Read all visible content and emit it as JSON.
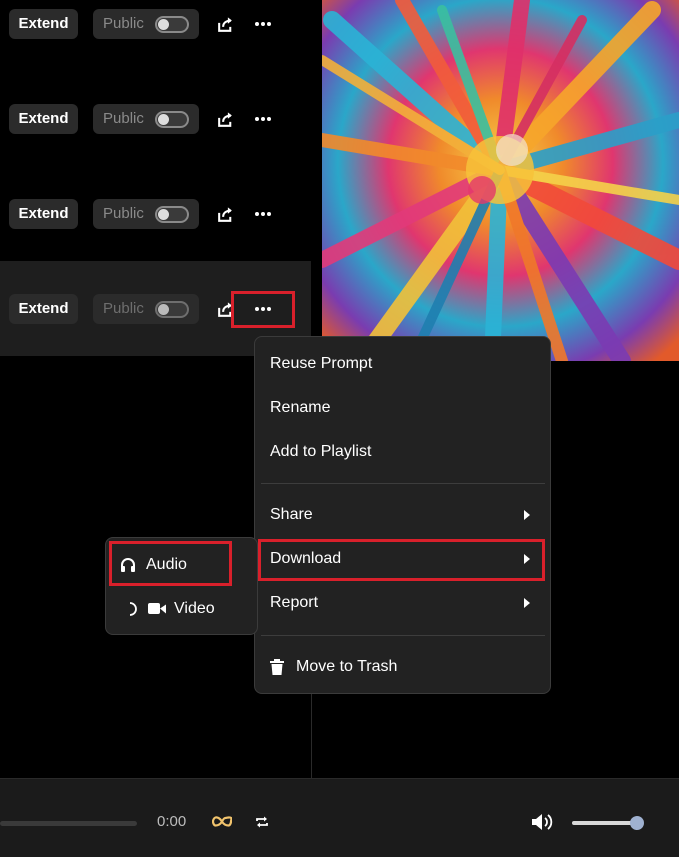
{
  "song_rows": [
    {
      "extend_label": "Extend",
      "public_label": "Public",
      "public_enabled": false
    },
    {
      "extend_label": "Extend",
      "public_label": "Public",
      "public_enabled": false
    },
    {
      "extend_label": "Extend",
      "public_label": "Public",
      "public_enabled": false
    },
    {
      "extend_label": "Extend",
      "public_label": "Public",
      "public_enabled": false,
      "selected": true
    }
  ],
  "context_menu": {
    "reuse_prompt": "Reuse Prompt",
    "rename": "Rename",
    "add_to_playlist": "Add to Playlist",
    "share": "Share",
    "download": "Download",
    "report": "Report",
    "move_to_trash": "Move to Trash"
  },
  "download_submenu": {
    "audio": "Audio",
    "video": "Video"
  },
  "player": {
    "time": "0:00",
    "progress_fraction": 0,
    "volume_fraction": 0.9
  },
  "colors": {
    "highlight": "#d9202b",
    "loop_icon": "#f2c46d",
    "menu_bg": "#222222"
  },
  "icons": [
    "share-icon",
    "more-icon",
    "headphones-icon",
    "video-camera-icon",
    "loading-spinner-icon",
    "trash-icon",
    "infinity-loop-icon",
    "repeat-icon",
    "volume-icon",
    "chevron-right-icon"
  ]
}
